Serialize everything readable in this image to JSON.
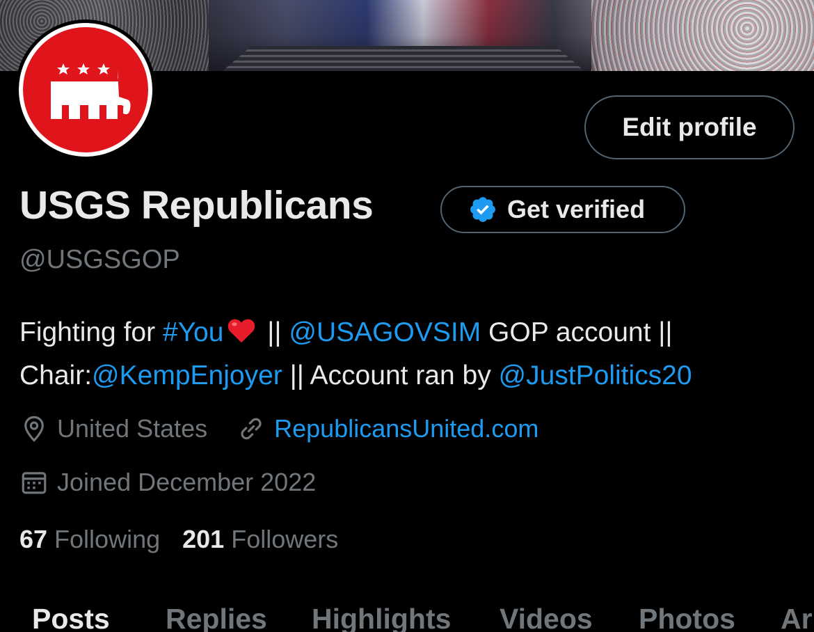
{
  "profile": {
    "display_name": "USGS Republicans",
    "handle": "@USGSGOP",
    "edit_profile_label": "Edit profile",
    "get_verified_label": "Get verified",
    "bio": {
      "part1": "Fighting for ",
      "hashtag": "#You",
      "part2": " || ",
      "mention1": "@USAGOVSIM",
      "part3": " GOP account ||",
      "part4": "Chair:",
      "mention2": "@KempEnjoyer",
      "part5": " || Account ran by ",
      "mention3": "@JustPolitics20"
    },
    "location": "United States",
    "website": "RepublicansUnited.com",
    "joined": "Joined December 2022",
    "following_count": "67",
    "following_label": "Following",
    "followers_count": "201",
    "followers_label": "Followers"
  },
  "tabs": [
    {
      "label": "Posts",
      "active": true
    },
    {
      "label": "Replies",
      "active": false
    },
    {
      "label": "Highlights",
      "active": false
    },
    {
      "label": "Videos",
      "active": false
    },
    {
      "label": "Photos",
      "active": false
    },
    {
      "label": "Ar",
      "active": false
    }
  ],
  "colors": {
    "background": "#000000",
    "text": "#e7e9ea",
    "secondary_text": "#71767b",
    "link": "#1d9bf0",
    "avatar_red": "#e0141b",
    "border": "#536471"
  },
  "icons": {
    "location": "location-pin-icon",
    "website": "link-icon",
    "joined": "calendar-icon",
    "verified": "verified-badge-icon",
    "heart": "red-heart-emoji"
  }
}
